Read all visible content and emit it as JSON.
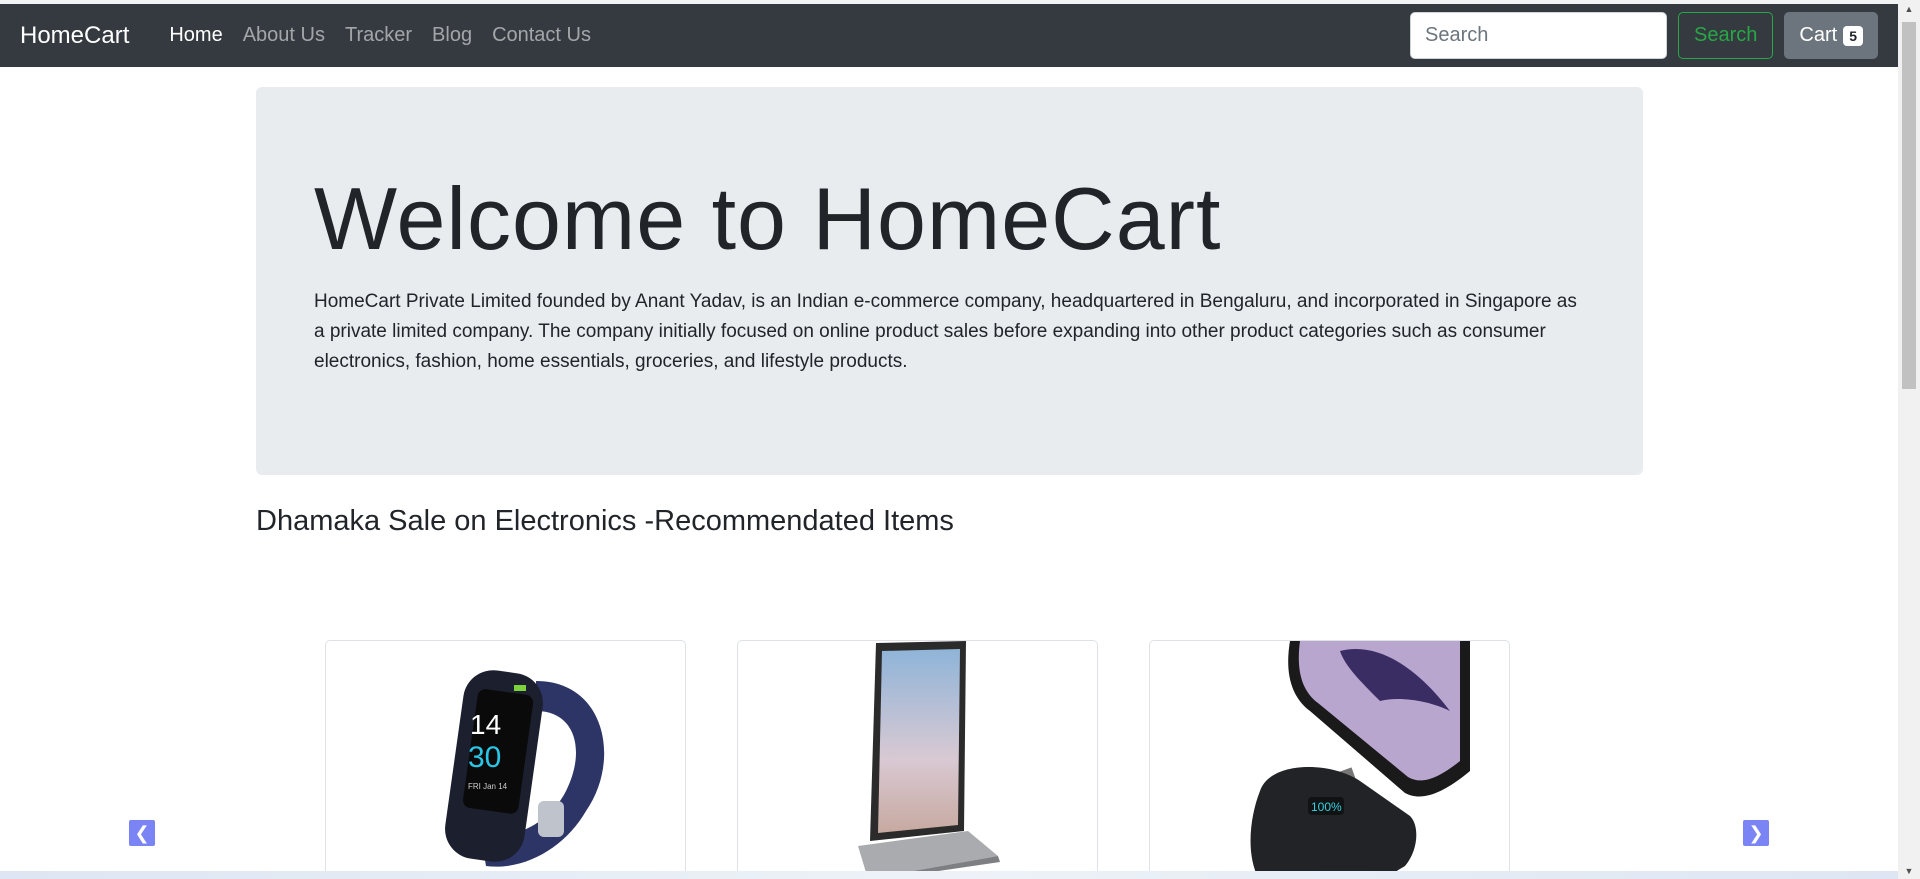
{
  "navbar": {
    "brand": "HomeCart",
    "links": [
      "Home",
      "About Us",
      "Tracker",
      "Blog",
      "Contact Us"
    ],
    "active_link": "Home",
    "search_placeholder": "Search",
    "search_button": "Search",
    "cart_label": "Cart",
    "cart_count": "5"
  },
  "hero": {
    "title": "Welcome to HomeCart",
    "text": "HomeCart Private Limited founded by Anant Yadav, is an Indian e-commerce company, headquartered in Bengaluru, and incorporated in Singapore as a private limited company. The company initially focused on online product sales before expanding into other product categories such as consumer electronics, fashion, home essentials, groceries, and lifestyle products."
  },
  "section": {
    "heading": "Dhamaka Sale on Electronics -Recommendated Items"
  },
  "carousel": {
    "prev_icon": "chevron-left-icon",
    "next_icon": "chevron-right-icon",
    "products": [
      {
        "image": "fitness-band-image",
        "watch_time_hour": "14",
        "watch_time_min": "30",
        "watch_date": "FRI Jan 14"
      },
      {
        "image": "laptop-image"
      },
      {
        "image": "phone-powerbank-image",
        "powerbank_display": "100%"
      }
    ]
  },
  "colors": {
    "navbar_bg": "#343a40",
    "jumbotron_bg": "#e9ecef",
    "search_button": "#28a745",
    "cart_button": "#6c757d",
    "carousel_arrow": "#7b84f4"
  }
}
